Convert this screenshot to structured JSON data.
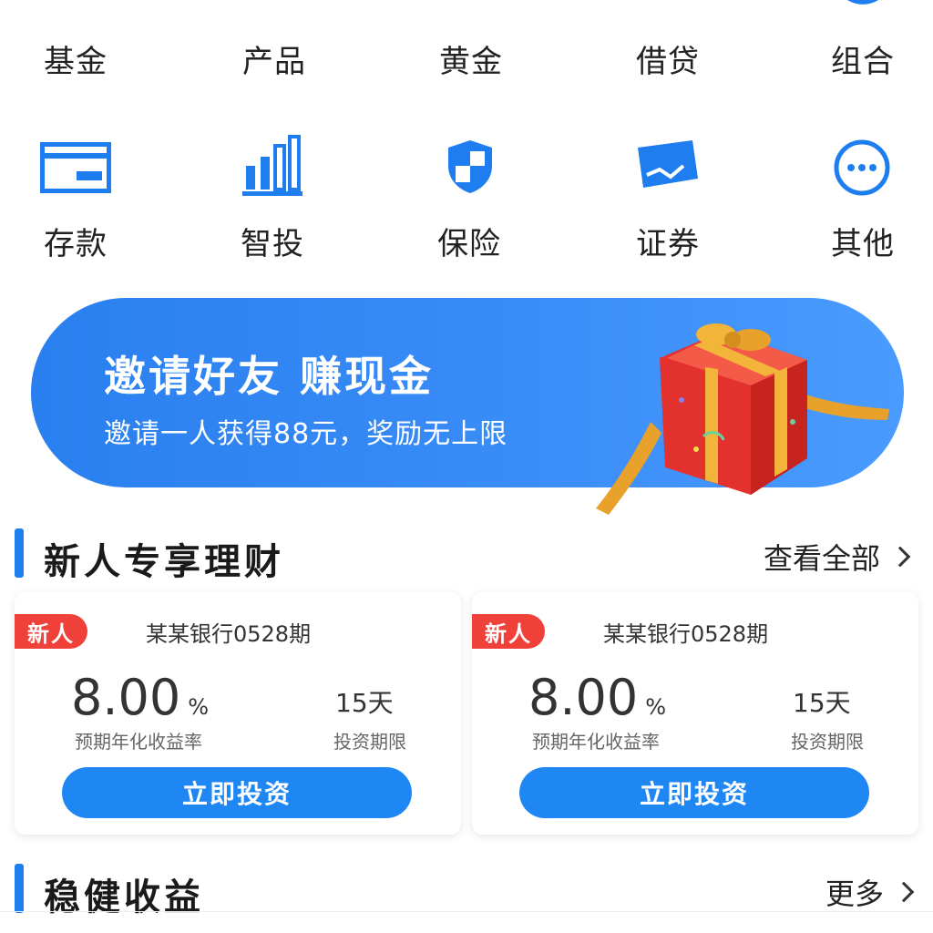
{
  "colors": {
    "primary": "#1e7ef0",
    "badge": "#f0403a",
    "banner": "#3a8cf5"
  },
  "grid": {
    "row1": [
      {
        "label": "基金",
        "icon": "wallet-icon"
      },
      {
        "label": "产品",
        "icon": "product-icon"
      },
      {
        "label": "黄金",
        "icon": "gold-icon"
      },
      {
        "label": "借贷",
        "icon": "loan-icon"
      },
      {
        "label": "组合",
        "icon": "portfolio-icon"
      }
    ],
    "row2": [
      {
        "label": "存款",
        "icon": "card-icon"
      },
      {
        "label": "智投",
        "icon": "bar-chart-icon"
      },
      {
        "label": "保险",
        "icon": "shield-icon"
      },
      {
        "label": "证券",
        "icon": "ticket-icon"
      },
      {
        "label": "其他",
        "icon": "more-icon"
      }
    ]
  },
  "banner": {
    "title": "邀请好友  赚现金",
    "subtitle": "邀请一人获得88元，奖励无上限",
    "image": "gift-box-icon"
  },
  "section1": {
    "title": "新人专享理财",
    "more": "查看全部"
  },
  "cards": [
    {
      "badge": "新人",
      "name": "某某银行0528期",
      "rate": "8.00",
      "rate_unit": "%",
      "rate_label": "预期年化收益率",
      "term": "15天",
      "term_label": "投资期限",
      "button": "立即投资"
    },
    {
      "badge": "新人",
      "name": "某某银行0528期",
      "rate": "8.00",
      "rate_unit": "%",
      "rate_label": "预期年化收益率",
      "term": "15天",
      "term_label": "投资期限",
      "button": "立即投资"
    }
  ],
  "section2": {
    "title": "稳健收益",
    "more": "更多"
  }
}
